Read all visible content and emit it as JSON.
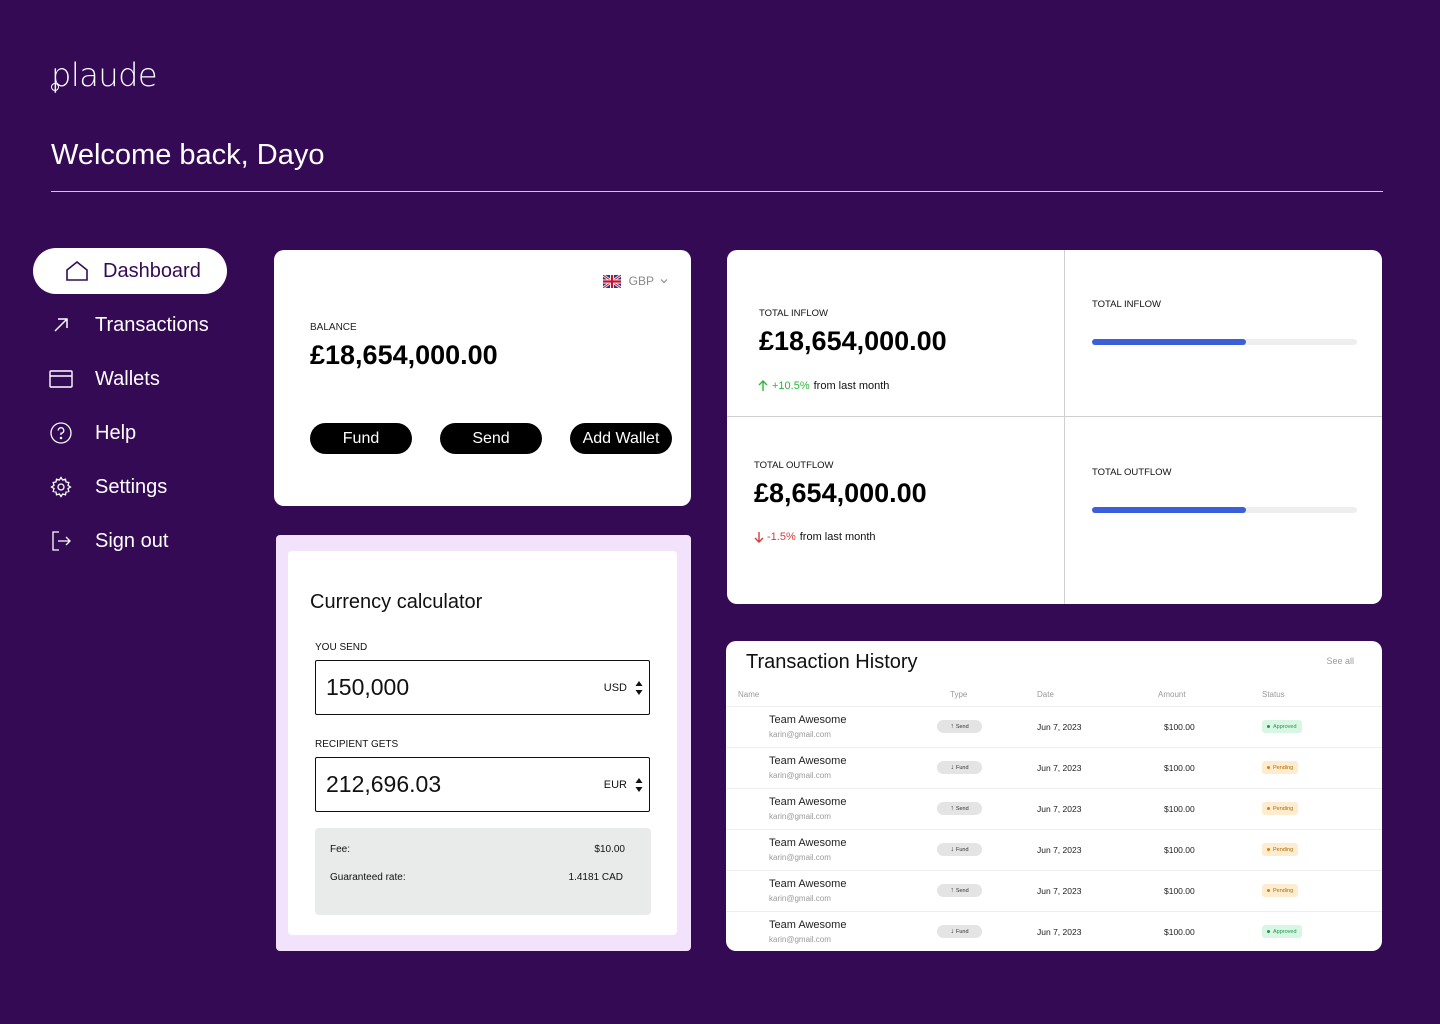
{
  "brand": {
    "name": "plaude"
  },
  "welcome": "Welcome back, Dayo",
  "sidebar": {
    "items": [
      {
        "label": "Dashboard",
        "icon": "home-icon",
        "active": true
      },
      {
        "label": "Transactions",
        "icon": "arrow-up-right-icon",
        "active": false
      },
      {
        "label": "Wallets",
        "icon": "card-icon",
        "active": false
      },
      {
        "label": "Help",
        "icon": "help-circle-icon",
        "active": false
      },
      {
        "label": "Settings",
        "icon": "gear-icon",
        "active": false
      },
      {
        "label": "Sign out",
        "icon": "sign-out-icon",
        "active": false
      }
    ]
  },
  "balance": {
    "currency": "GBP",
    "label": "BALANCE",
    "value": "£18,654,000.00",
    "buttons": {
      "fund": "Fund",
      "send": "Send",
      "add_wallet": "Add Wallet"
    }
  },
  "calculator": {
    "title": "Currency calculator",
    "send_label": "YOU SEND",
    "send_value": "150,000",
    "send_currency": "USD",
    "receive_label": "RECIPIENT GETS",
    "receive_value": "212,696.03",
    "receive_currency": "EUR",
    "fee_label": "Fee:",
    "fee_value": "$10.00",
    "rate_label": "Guaranteed rate:",
    "rate_value": "1.4181 CAD"
  },
  "flows": {
    "inflow": {
      "label": "TOTAL INFLOW",
      "value": "£18,654,000.00",
      "delta": "+10.5%",
      "delta_suffix": "from last month",
      "bar_label": "TOTAL INFLOW",
      "bar_fraction": 0.58
    },
    "outflow": {
      "label": "TOTAL OUTFLOW",
      "value": "£8,654,000.00",
      "delta": "-1.5%",
      "delta_suffix": "from last month",
      "bar_label": "TOTAL OUTFLOW",
      "bar_fraction": 0.58
    },
    "colors": {
      "up": "#2fb53a",
      "down": "#d83a3a",
      "bar": "#3b5fd9"
    }
  },
  "transactions": {
    "title": "Transaction History",
    "see_all": "See all",
    "headers": {
      "name": "Name",
      "type": "Type",
      "date": "Date",
      "amount": "Amount",
      "status": "Status"
    },
    "rows": [
      {
        "name": "Team Awesome",
        "email": "karin@gmail.com",
        "type": "Send",
        "date": "Jun 7, 2023",
        "amount": "$100.00",
        "status": "Approved"
      },
      {
        "name": "Team Awesome",
        "email": "karin@gmail.com",
        "type": "Fund",
        "date": "Jun 7, 2023",
        "amount": "$100.00",
        "status": "Pending"
      },
      {
        "name": "Team Awesome",
        "email": "karin@gmail.com",
        "type": "Send",
        "date": "Jun 7, 2023",
        "amount": "$100.00",
        "status": "Pending"
      },
      {
        "name": "Team Awesome",
        "email": "karin@gmail.com",
        "type": "Fund",
        "date": "Jun 7, 2023",
        "amount": "$100.00",
        "status": "Pending"
      },
      {
        "name": "Team Awesome",
        "email": "karin@gmail.com",
        "type": "Send",
        "date": "Jun 7, 2023",
        "amount": "$100.00",
        "status": "Pending"
      },
      {
        "name": "Team Awesome",
        "email": "karin@gmail.com",
        "type": "Fund",
        "date": "Jun 7, 2023",
        "amount": "$100.00",
        "status": "Approved"
      }
    ]
  }
}
